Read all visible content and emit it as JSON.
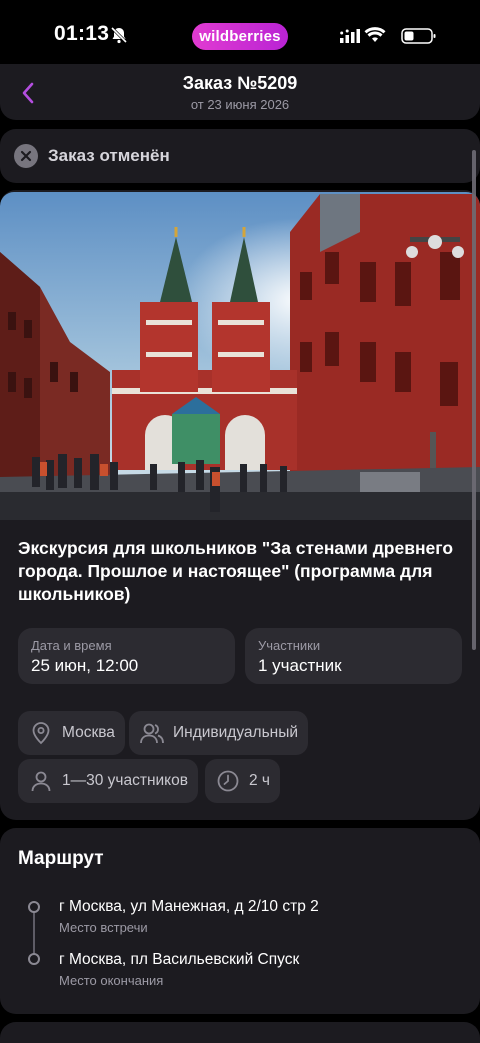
{
  "status_bar": {
    "time": "01:13",
    "brand": "wildberries"
  },
  "header": {
    "title": "Заказ №5209",
    "subtitle": "от 23 июня 2026"
  },
  "order_status": {
    "text": "Заказ отменён"
  },
  "tour": {
    "title": "Экскурсия для школьников \"За стенами древнего города. Прошлое и настоящее\" (программа для школьников)",
    "datetime_label": "Дата и время",
    "datetime_value": "25 июн, 12:00",
    "participants_label": "Участники",
    "participants_value": "1 участник",
    "chips": {
      "city": "Москва",
      "type": "Индивидуальный",
      "group": "1—30 участников",
      "duration": "2 ч"
    }
  },
  "route": {
    "title": "Маршрут",
    "start_address": "г Москва, ул Манежная, д 2/10 стр 2",
    "start_label": "Место встречи",
    "end_address": "г Москва, пл Васильевский Спуск",
    "end_label": "Место окончания"
  },
  "colors": {
    "accent": "#c026d3",
    "card": "#1c1b20",
    "chip": "#2c2b31"
  }
}
